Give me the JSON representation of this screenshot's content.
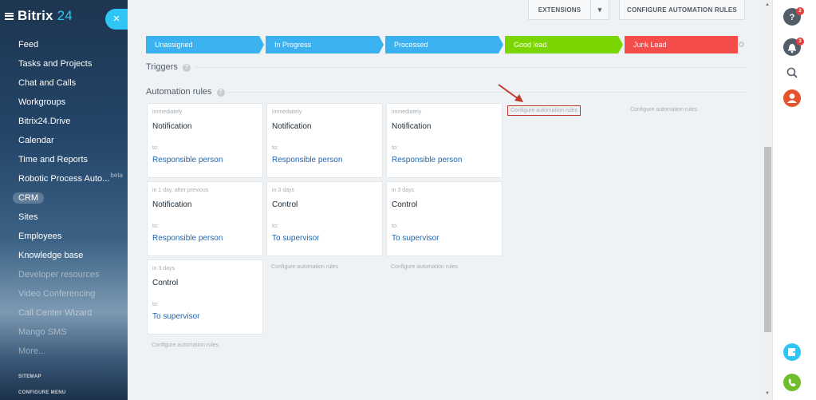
{
  "sidebar": {
    "logo_main": "Bitrix",
    "logo_num": " 24",
    "collapse_symbol": "×",
    "items": [
      {
        "label": "Feed"
      },
      {
        "label": "Tasks and Projects"
      },
      {
        "label": "Chat and Calls"
      },
      {
        "label": "Workgroups"
      },
      {
        "label": "Bitrix24.Drive"
      },
      {
        "label": "Calendar"
      },
      {
        "label": "Time and Reports"
      },
      {
        "label": "Robotic Process Auto...",
        "badge": "beta"
      },
      {
        "label": "CRM"
      },
      {
        "label": "Sites"
      },
      {
        "label": "Employees"
      },
      {
        "label": "Knowledge base"
      },
      {
        "label": "Developer resources"
      },
      {
        "label": "Video Conferencing"
      },
      {
        "label": "Call Center Wizard"
      },
      {
        "label": "Mango SMS"
      },
      {
        "label": "More..."
      }
    ],
    "sitemap": "SITEMAP",
    "configure_menu": "CONFIGURE MENU"
  },
  "toolbar": {
    "extensions_label": "EXTENSIONS",
    "extensions_dropdown_glyph": "▾",
    "configure_label": "CONFIGURE AUTOMATION RULES"
  },
  "stages": [
    {
      "label": "Unassigned",
      "color": "#3bb1f0"
    },
    {
      "label": "In Progress",
      "color": "#3bb1f0"
    },
    {
      "label": "Processed",
      "color": "#3bb1f0"
    },
    {
      "label": "Good lead",
      "color": "#7bd500"
    },
    {
      "label": "Junk Lead",
      "color": "#f54c4c"
    }
  ],
  "triggers": {
    "title": "Triggers",
    "help": "?"
  },
  "automation": {
    "title": "Automation rules",
    "help": "?",
    "configure_link": "Configure automation rules",
    "to_label": "to:",
    "cards": [
      {
        "delay": "immediately",
        "action": "Notification",
        "target": "Responsible person"
      },
      {
        "delay": "in 1 day, after previous",
        "action": "Notification",
        "target": "Responsible person"
      },
      {
        "delay": "in 3 days",
        "action": "Control",
        "target": "To supervisor"
      },
      {
        "delay": "immediately",
        "action": "Notification",
        "target": "Responsible person"
      },
      {
        "delay": "in 3 days",
        "action": "Control",
        "target": "To supervisor"
      },
      {
        "delay": "immediately",
        "action": "Notification",
        "target": "Responsible person"
      },
      {
        "delay": "in 3 days",
        "action": "Control",
        "target": "To supervisor"
      }
    ]
  },
  "right_panel": {
    "help_badge": "2",
    "notification_badge": "3"
  },
  "colors": {
    "accent": "#2fc6f6",
    "link": "#2067b0",
    "highlight_border": "#c0392b",
    "arrow": "#c0392b",
    "phone": "#6fbd2a",
    "user": "#e5532c"
  }
}
